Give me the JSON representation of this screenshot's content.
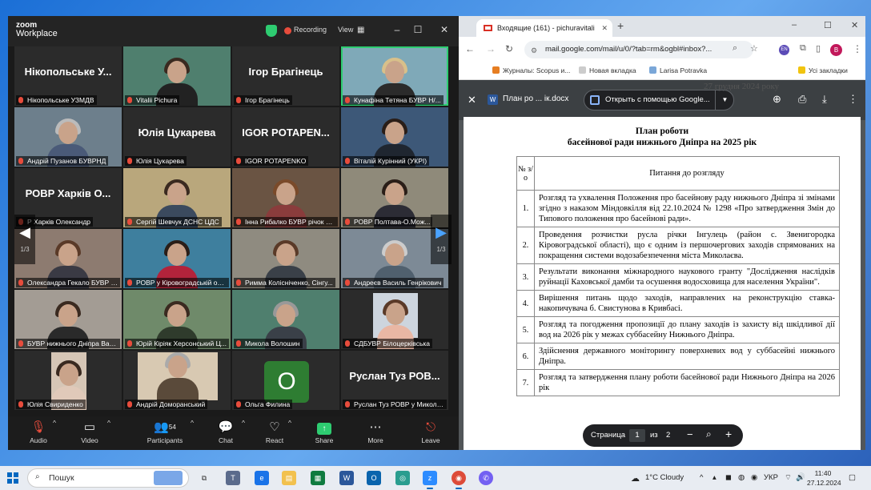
{
  "zoom": {
    "logo_line1": "zoom",
    "logo_line2": "Workplace",
    "recording": "Recording",
    "view": "View",
    "page_left": "1/3",
    "page_right": "1/3",
    "tiles": [
      {
        "big": "Нікопольське У...",
        "caption": "Нікопольське УЗМДВ"
      },
      {
        "big": "",
        "caption": "Vitalii Pichura"
      },
      {
        "big": "Ігор Брагінець",
        "caption": "Ігор Брагінець"
      },
      {
        "big": "",
        "caption": "Кунафіна Тетяна БУВР Н/..."
      },
      {
        "big": "",
        "caption": "Андрій Пузанов БУВРНД"
      },
      {
        "big": "Юлія Цукарева",
        "caption": "Юлія Цукарева"
      },
      {
        "big": "IGOR POTAPEN...",
        "caption": "IGOR POTAPENKO"
      },
      {
        "big": "",
        "caption": "Віталій Курінний (УКРІ)"
      },
      {
        "big": "РОВР Харків О...",
        "caption": "Р Харків Олександр"
      },
      {
        "big": "",
        "caption": "Сергій Шевчук ДСНС ЦДС"
      },
      {
        "big": "",
        "caption": "Інна Рибалко БУВР річок П..."
      },
      {
        "big": "",
        "caption": "РОВР Полтава-О.Мож..."
      },
      {
        "big": "",
        "caption": "Олександра Гекало БУВР н..."
      },
      {
        "big": "",
        "caption": "РОВР у Кіровоградській об..."
      },
      {
        "big": "",
        "caption": "Римма Колісніченко, Сінгу..."
      },
      {
        "big": "",
        "caption": "Андреєв Василь Генрікович"
      },
      {
        "big": "",
        "caption": "БУВР нижнього Дніпра Вал..."
      },
      {
        "big": "",
        "caption": "Юрій Кіріяк Херсонський Ц..."
      },
      {
        "big": "",
        "caption": "Микола Волошин"
      },
      {
        "big": "",
        "caption": "СДБУВР Білоцерківська"
      },
      {
        "big": "",
        "caption": "Юлія Свириденко"
      },
      {
        "big": "",
        "caption": "Андрій Доморанський"
      },
      {
        "big": "O",
        "caption": "Ольга Филина"
      },
      {
        "big": "Руслан Туз РОВ...",
        "caption": "Руслан Туз РОВР у Миколаї..."
      }
    ],
    "toolbar": {
      "audio": "Audio",
      "video": "Video",
      "participants": "Participants",
      "participants_count": "54",
      "chat": "Chat",
      "react": "React",
      "share": "Share",
      "more": "More",
      "leave": "Leave"
    }
  },
  "chrome": {
    "tab_title": "Входящие (161) - pichuravitali",
    "url": "mail.google.com/mail/u/0/?tab=rm&ogbl#inbox?...",
    "profile_initial": "B",
    "ext_label": "EN",
    "bookmarks": [
      "Журналы: Scopus и...",
      "Новая вкладка",
      "Larisa Potravka",
      "Усі закладки"
    ],
    "viewer": {
      "file_name": "План ро ... ік.docx",
      "open_with": "Открыть с помощью Google...",
      "prev_text": "27 грудня 2024 року",
      "title_line1": "План роботи",
      "title_line2": "басейнової ради нижнього Дніпра на 2025 рік",
      "col_num": "№ з/о",
      "col_topic": "Питання до розгляду",
      "rows": [
        {
          "n": "1.",
          "text": "Розгляд та ухвалення Положення про басейнову раду нижнього Дніпра зі змінами згідно з наказом Міндовкілля від 22.10.2024 № 1298 «Про затвердження Змін до Типового положення про басейнові ради»."
        },
        {
          "n": "2.",
          "text": "Проведення розчистки русла річки Інгулець (район с. Звенигородка Кіровоградської області), що є одним із першочергових заходів спрямованих на покращення системи водозабезпечення міста Миколаєва."
        },
        {
          "n": "3.",
          "text": "Результати виконання міжнародного наукового гранту \"Дослідження наслідків руйнації Каховської дамби та осушення водосховища для населення України\"."
        },
        {
          "n": "4.",
          "text": "Вирішення питань щодо заходів, направлених на реконструкцію ставка-накопичувача б. Свистунова в Кривбасі."
        },
        {
          "n": "5.",
          "text": "Розгляд та погодження пропозиції до плану заходів із захисту від шкідливої дії вод на 2026 рік у межах суббасейну Нижнього Дніпра."
        },
        {
          "n": "6.",
          "text": "Здійснення державного моніторингу поверхневих вод у суббасейні нижнього Дніпра."
        },
        {
          "n": "7.",
          "text": "Розгляд та затвердження плану роботи басейнової ради Нижнього Дніпра на 2026 рік"
        }
      ],
      "pager_label": "Страница",
      "pager_current": "1",
      "pager_of": "из",
      "pager_total": "2"
    }
  },
  "taskbar": {
    "search": "Пошук",
    "weather": "1°C Cloudy",
    "lang": "УКР",
    "time": "11:40",
    "date": "27.12.2024"
  },
  "colors": {
    "zoom_bg": "#1a1a1a",
    "zoom_active": "#2ecc71",
    "leave": "#e74c3c",
    "chrome_viewer": "#525659"
  }
}
